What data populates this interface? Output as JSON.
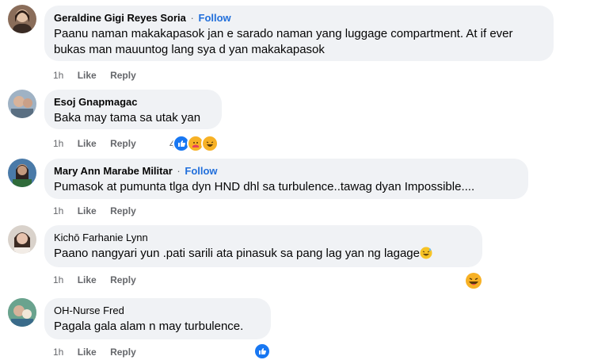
{
  "comments": [
    {
      "name": "Geraldine Gigi Reyes Soria",
      "separator": "·",
      "follow": "Follow",
      "text_lines": [
        "Paanu naman makakapasok jan e sarado naman yang luggage compartment. At if ever",
        "bukas man mauuntog lang sya d yan makakapasok"
      ],
      "time": "1h",
      "like": "Like",
      "reply": "Reply"
    },
    {
      "name": "Esoj Gnapmagac",
      "text_lines": [
        "Baka may tama sa utak yan"
      ],
      "time": "1h",
      "like": "Like",
      "reply": "Reply",
      "reaction_count": "4",
      "reaction_icons": [
        "like-icon",
        "care-icon",
        "haha-icon"
      ]
    },
    {
      "name": "Mary Ann Marabe Militar",
      "separator": "·",
      "follow": "Follow",
      "text_lines": [
        "Pumasok at pumunta tlga dyn HND dhl sa turbulence..tawag dyan Impossible...."
      ],
      "time": "1h",
      "like": "Like",
      "reply": "Reply"
    },
    {
      "name": "Kichō Farhanie Lynn",
      "text_lines": [
        "Paano nangyari yun .pati sarili ata pinasuk sa pang lag yan ng lagage"
      ],
      "time": "1h",
      "like": "Like",
      "reply": "Reply",
      "reaction_icons": [
        "haha-icon"
      ]
    },
    {
      "name": "OH-Nurse Fred",
      "text_lines": [
        "Pagala gala alam n may turbulence."
      ],
      "time": "1h",
      "like": "Like",
      "reply": "Reply",
      "reaction_icons": [
        "like-icon"
      ]
    }
  ],
  "colors": {
    "bubble": "#f0f2f5",
    "follow": "#216fdb",
    "meta": "#65676b",
    "like_reaction": "#1877f2",
    "haha_reaction": "#f7b125"
  }
}
